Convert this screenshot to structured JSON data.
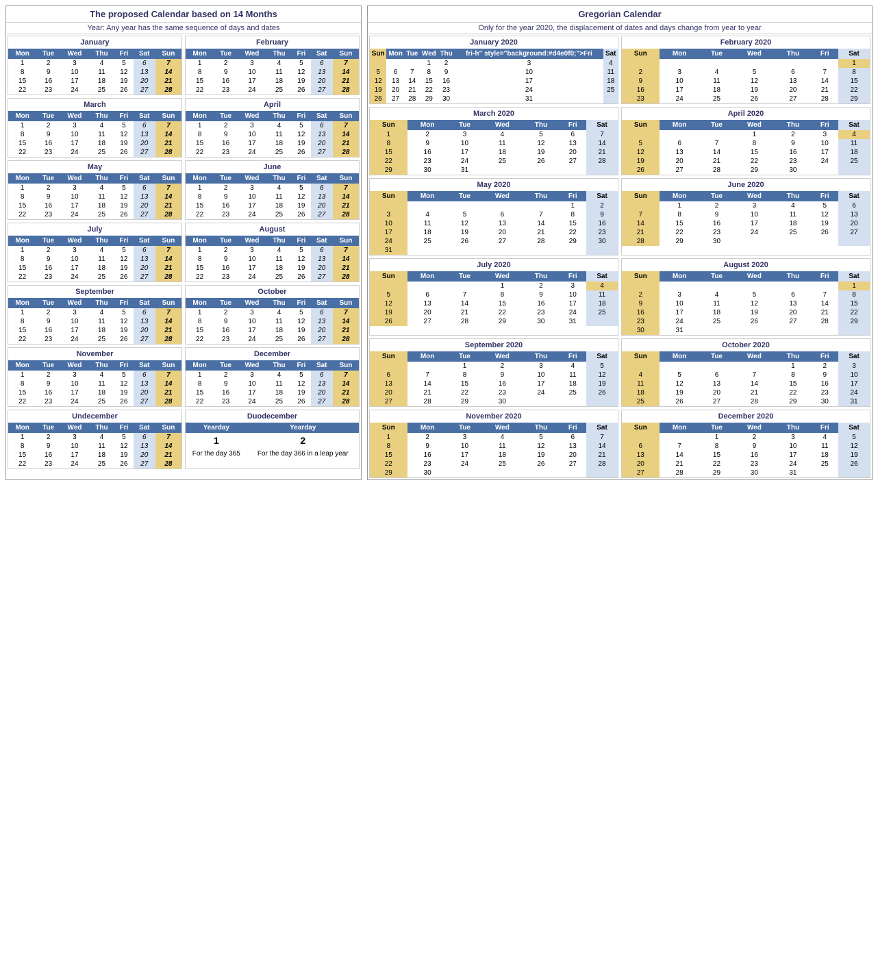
{
  "left": {
    "title": "The proposed Calendar based on 14 Months",
    "subtitle": "Year: Any year has the same sequence of days and dates",
    "months": [
      {
        "name": "January"
      },
      {
        "name": "February"
      },
      {
        "name": "March"
      },
      {
        "name": "April"
      },
      {
        "name": "May"
      },
      {
        "name": "June"
      },
      {
        "name": "July"
      },
      {
        "name": "August"
      },
      {
        "name": "September"
      },
      {
        "name": "October"
      },
      {
        "name": "November"
      },
      {
        "name": "December"
      },
      {
        "name": "Undecember"
      },
      {
        "name": "Duodecember"
      }
    ],
    "days_header": [
      "Mon",
      "Tue",
      "Wed",
      "Thu",
      "Fri",
      "Sat",
      "Sun"
    ],
    "standard_weeks": [
      [
        1,
        2,
        3,
        4,
        5,
        6,
        7
      ],
      [
        8,
        9,
        10,
        11,
        12,
        13,
        14
      ],
      [
        15,
        16,
        17,
        18,
        19,
        20,
        21
      ],
      [
        22,
        23,
        24,
        25,
        26,
        27,
        28
      ]
    ]
  },
  "right": {
    "title": "Gregorian Calendar",
    "subtitle": "Only for the year 2020, the displacement of dates and days change from year to year",
    "months": [
      {
        "name": "January 2020",
        "headers": [
          "Sun",
          "Mon",
          "Tue",
          "Wed",
          "Thu",
          "Fri",
          "Sat"
        ],
        "weeks": [
          [
            "",
            "",
            "",
            "1",
            "2",
            "3",
            "4"
          ],
          [
            "5",
            "6",
            "7",
            "8",
            "9",
            "10",
            "11"
          ],
          [
            "12",
            "13",
            "14",
            "15",
            "16",
            "17",
            "18"
          ],
          [
            "19",
            "20",
            "21",
            "22",
            "23",
            "24",
            "25"
          ],
          [
            "26",
            "27",
            "28",
            "29",
            "30",
            "31",
            ""
          ]
        ]
      },
      {
        "name": "February 2020",
        "headers": [
          "Sun",
          "Mon",
          "Tue",
          "Wed",
          "Thu",
          "Fri",
          "Sat"
        ],
        "weeks": [
          [
            "",
            "",
            "",
            "",
            "",
            "",
            "1"
          ],
          [
            "2",
            "3",
            "4",
            "5",
            "6",
            "7",
            "8"
          ],
          [
            "9",
            "10",
            "11",
            "12",
            "13",
            "14",
            "15"
          ],
          [
            "16",
            "17",
            "18",
            "19",
            "20",
            "21",
            "22"
          ],
          [
            "23",
            "24",
            "25",
            "26",
            "27",
            "28",
            "29"
          ]
        ]
      },
      {
        "name": "March 2020",
        "headers": [
          "Sun",
          "Mon",
          "Tue",
          "Wed",
          "Thu",
          "Fri",
          "Sat"
        ],
        "weeks": [
          [
            "1",
            "2",
            "3",
            "4",
            "5",
            "6",
            "7"
          ],
          [
            "8",
            "9",
            "10",
            "11",
            "12",
            "13",
            "14"
          ],
          [
            "15",
            "16",
            "17",
            "18",
            "19",
            "20",
            "21"
          ],
          [
            "22",
            "23",
            "24",
            "25",
            "26",
            "27",
            "28"
          ],
          [
            "29",
            "30",
            "31",
            "",
            "",
            "",
            ""
          ]
        ]
      },
      {
        "name": "April 2020",
        "headers": [
          "Sun",
          "Mon",
          "Tue",
          "Wed",
          "Thu",
          "Fri",
          "Sat"
        ],
        "weeks": [
          [
            "",
            "",
            "",
            "1",
            "2",
            "3",
            "4"
          ],
          [
            "5",
            "6",
            "7",
            "8",
            "9",
            "10",
            "11"
          ],
          [
            "12",
            "13",
            "14",
            "15",
            "16",
            "17",
            "18"
          ],
          [
            "19",
            "20",
            "21",
            "22",
            "23",
            "24",
            "25"
          ],
          [
            "26",
            "27",
            "28",
            "29",
            "30",
            "",
            ""
          ]
        ]
      },
      {
        "name": "May 2020",
        "headers": [
          "Sun",
          "Mon",
          "Tue",
          "Wed",
          "Thu",
          "Fri",
          "Sat"
        ],
        "weeks": [
          [
            "",
            "",
            "",
            "",
            "",
            "1",
            "2"
          ],
          [
            "3",
            "4",
            "5",
            "6",
            "7",
            "8",
            "9"
          ],
          [
            "10",
            "11",
            "12",
            "13",
            "14",
            "15",
            "16"
          ],
          [
            "17",
            "18",
            "19",
            "20",
            "21",
            "22",
            "23"
          ],
          [
            "24",
            "25",
            "26",
            "27",
            "28",
            "29",
            "30"
          ],
          [
            "31",
            "",
            "",
            "",
            "",
            "",
            ""
          ]
        ]
      },
      {
        "name": "June 2020",
        "headers": [
          "Sun",
          "Mon",
          "Tue",
          "Wed",
          "Thu",
          "Fri",
          "Sat"
        ],
        "weeks": [
          [
            "",
            "1",
            "2",
            "3",
            "4",
            "5",
            "6"
          ],
          [
            "7",
            "8",
            "9",
            "10",
            "11",
            "12",
            "13"
          ],
          [
            "14",
            "15",
            "16",
            "17",
            "18",
            "19",
            "20"
          ],
          [
            "21",
            "22",
            "23",
            "24",
            "25",
            "26",
            "27"
          ],
          [
            "28",
            "29",
            "30",
            "",
            "",
            "",
            ""
          ]
        ]
      },
      {
        "name": "July 2020",
        "headers": [
          "Sun",
          "Mon",
          "Tue",
          "Wed",
          "Thu",
          "Fri",
          "Sat"
        ],
        "weeks": [
          [
            "",
            "",
            "",
            "1",
            "2",
            "3",
            "4"
          ],
          [
            "5",
            "6",
            "7",
            "8",
            "9",
            "10",
            "11"
          ],
          [
            "12",
            "13",
            "14",
            "15",
            "16",
            "17",
            "18"
          ],
          [
            "19",
            "20",
            "21",
            "22",
            "23",
            "24",
            "25"
          ],
          [
            "26",
            "27",
            "28",
            "29",
            "30",
            "31",
            ""
          ]
        ]
      },
      {
        "name": "August 2020",
        "headers": [
          "Sun",
          "Mon",
          "Tue",
          "Wed",
          "Thu",
          "Fri",
          "Sat"
        ],
        "weeks": [
          [
            "",
            "",
            "",
            "",
            "",
            "",
            "1"
          ],
          [
            "2",
            "3",
            "4",
            "5",
            "6",
            "7",
            "8"
          ],
          [
            "9",
            "10",
            "11",
            "12",
            "13",
            "14",
            "15"
          ],
          [
            "16",
            "17",
            "18",
            "19",
            "20",
            "21",
            "22"
          ],
          [
            "23",
            "24",
            "25",
            "26",
            "27",
            "28",
            "29"
          ],
          [
            "30",
            "31",
            "",
            "",
            "",
            "",
            ""
          ]
        ]
      },
      {
        "name": "September 2020",
        "headers": [
          "Sun",
          "Mon",
          "Tue",
          "Wed",
          "Thu",
          "Fri",
          "Sat"
        ],
        "weeks": [
          [
            "",
            "",
            "1",
            "2",
            "3",
            "4",
            "5"
          ],
          [
            "6",
            "7",
            "8",
            "9",
            "10",
            "11",
            "12"
          ],
          [
            "13",
            "14",
            "15",
            "16",
            "17",
            "18",
            "19"
          ],
          [
            "20",
            "21",
            "22",
            "23",
            "24",
            "25",
            "26"
          ],
          [
            "27",
            "28",
            "29",
            "30",
            "",
            "",
            ""
          ]
        ]
      },
      {
        "name": "October 2020",
        "headers": [
          "Sun",
          "Mon",
          "Tue",
          "Wed",
          "Thu",
          "Fri",
          "Sat"
        ],
        "weeks": [
          [
            "",
            "",
            "",
            "",
            "1",
            "2",
            "3"
          ],
          [
            "4",
            "5",
            "6",
            "7",
            "8",
            "9",
            "10"
          ],
          [
            "11",
            "12",
            "13",
            "14",
            "15",
            "16",
            "17"
          ],
          [
            "18",
            "19",
            "20",
            "21",
            "22",
            "23",
            "24"
          ],
          [
            "25",
            "26",
            "27",
            "28",
            "29",
            "30",
            "31"
          ]
        ]
      },
      {
        "name": "November 2020",
        "headers": [
          "Sun",
          "Mon",
          "Tue",
          "Wed",
          "Thu",
          "Fri",
          "Sat"
        ],
        "weeks": [
          [
            "1",
            "2",
            "3",
            "4",
            "5",
            "6",
            "7"
          ],
          [
            "8",
            "9",
            "10",
            "11",
            "12",
            "13",
            "14"
          ],
          [
            "15",
            "16",
            "17",
            "18",
            "19",
            "20",
            "21"
          ],
          [
            "22",
            "23",
            "24",
            "25",
            "26",
            "27",
            "28"
          ],
          [
            "29",
            "30",
            "",
            "",
            "",
            "",
            ""
          ]
        ]
      },
      {
        "name": "December 2020",
        "headers": [
          "Sun",
          "Mon",
          "Tue",
          "Wed",
          "Thu",
          "Fri",
          "Sat"
        ],
        "weeks": [
          [
            "",
            "",
            "1",
            "2",
            "3",
            "4",
            "5"
          ],
          [
            "6",
            "7",
            "8",
            "9",
            "10",
            "11",
            "12"
          ],
          [
            "13",
            "14",
            "15",
            "16",
            "17",
            "18",
            "19"
          ],
          [
            "20",
            "21",
            "22",
            "23",
            "24",
            "25",
            "26"
          ],
          [
            "27",
            "28",
            "29",
            "30",
            "31",
            "",
            ""
          ]
        ]
      }
    ]
  }
}
